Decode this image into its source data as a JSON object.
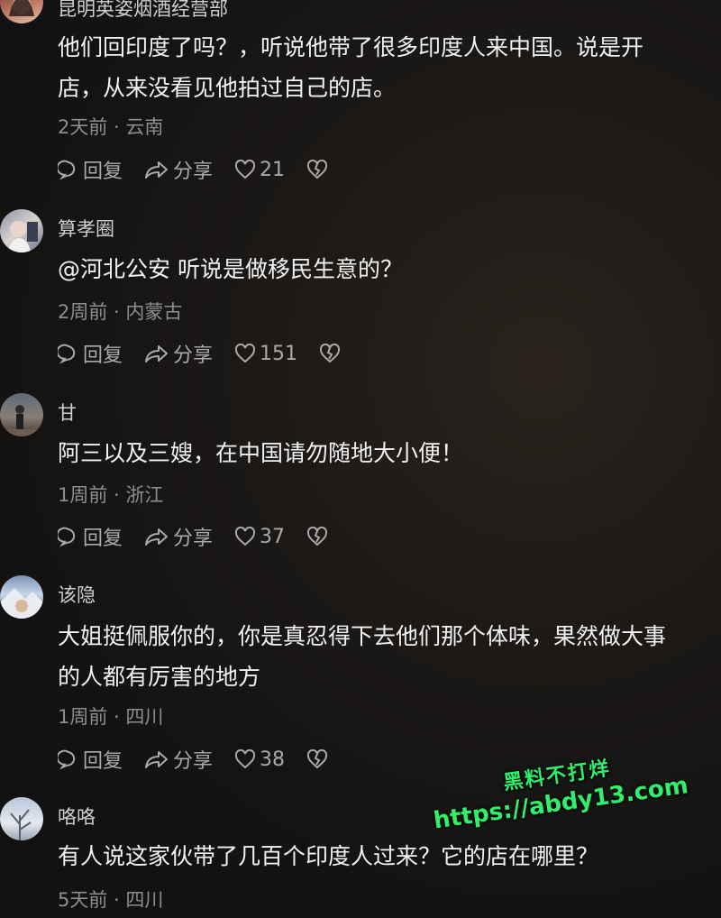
{
  "comments": [
    {
      "username": "昆明英姿烟酒经营部",
      "lines": [
        "他们回印度了吗？，听说他带了很多印度人来中国。说是开",
        "店，从来没看见他拍过自己的店。"
      ],
      "meta": "2天前 · 云南",
      "reply": "回复",
      "share": "分享",
      "likes": "21"
    },
    {
      "username": "算孝圈",
      "lines": [
        "@河北公安  听说是做移民生意的？"
      ],
      "meta": "2周前 · 内蒙古",
      "reply": "回复",
      "share": "分享",
      "likes": "151"
    },
    {
      "username": "甘",
      "lines": [
        "阿三以及三嫂，在中国请勿随地大小便！"
      ],
      "meta": "1周前 · 浙江",
      "reply": "回复",
      "share": "分享",
      "likes": "37"
    },
    {
      "username": "该隐",
      "lines": [
        "大姐挺佩服你的，你是真忍得下去他们那个体味，果然做大事",
        "的人都有厉害的地方"
      ],
      "meta": "1周前 · 四川",
      "reply": "回复",
      "share": "分享",
      "likes": "38"
    },
    {
      "username": "咯咯",
      "lines": [
        "有人说这家伙带了几百个印度人过来？它的店在哪里？"
      ],
      "meta": "5天前 · 四川"
    }
  ],
  "watermark": {
    "line1": "黑料不打烊",
    "line2": "https://abdy13.com"
  },
  "colors": {
    "accent_watermark": "#2ff06a",
    "meta": "#8e8e8e",
    "text": "#f2f2f2"
  }
}
